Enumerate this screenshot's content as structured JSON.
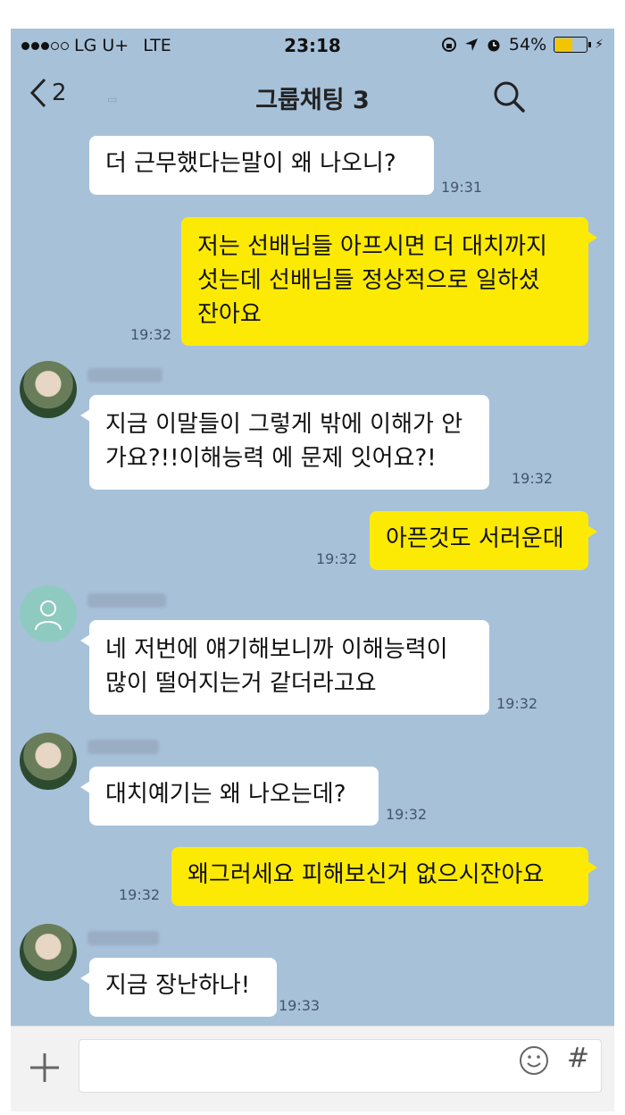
{
  "status_bar": {
    "carrier": "LG U+",
    "network": "LTE",
    "time": "23:18",
    "battery": "54%",
    "battery_level": 0.54
  },
  "header": {
    "back_count": "2",
    "title": "그룹채팅 3"
  },
  "messages": [
    {
      "side": "left",
      "text": "더 근무했다는말이 왜 나오니?",
      "time": "19:31"
    },
    {
      "side": "right",
      "text": "저는 선배님들 아프시면 더 대치까지\n섯는데 선배님들 정상적으로 일하셨\n잔아요",
      "time": "19:32"
    },
    {
      "side": "left",
      "text": "지금 이말들이 그렇게 밖에 이해가 안\n가요?!!이해능력 에 문제 잇어요?!",
      "time": "19:32"
    },
    {
      "side": "right",
      "text": "아픈것도 서러운대",
      "time": "19:32"
    },
    {
      "side": "left",
      "text": "네 저번에 얘기해보니까 이해능력이\n많이 떨어지는거 같더라고요",
      "time": "19:32"
    },
    {
      "side": "left",
      "text": "대치예기는 왜 나오는데?",
      "time": "19:32"
    },
    {
      "side": "right",
      "text": "왜그러세요 피해보신거 없으시잔아요",
      "time": "19:32"
    },
    {
      "side": "left",
      "text": "지금 장난하나!",
      "time": "19:33"
    }
  ],
  "colors": {
    "chat_background": "#a7c1d9",
    "my_bubble": "#fdea04",
    "other_bubble": "#ffffff",
    "battery_fill": "#f3c500"
  },
  "icons": [
    "back-chevron-icon",
    "search-icon",
    "plus-icon",
    "emoji-icon",
    "hash-icon"
  ]
}
